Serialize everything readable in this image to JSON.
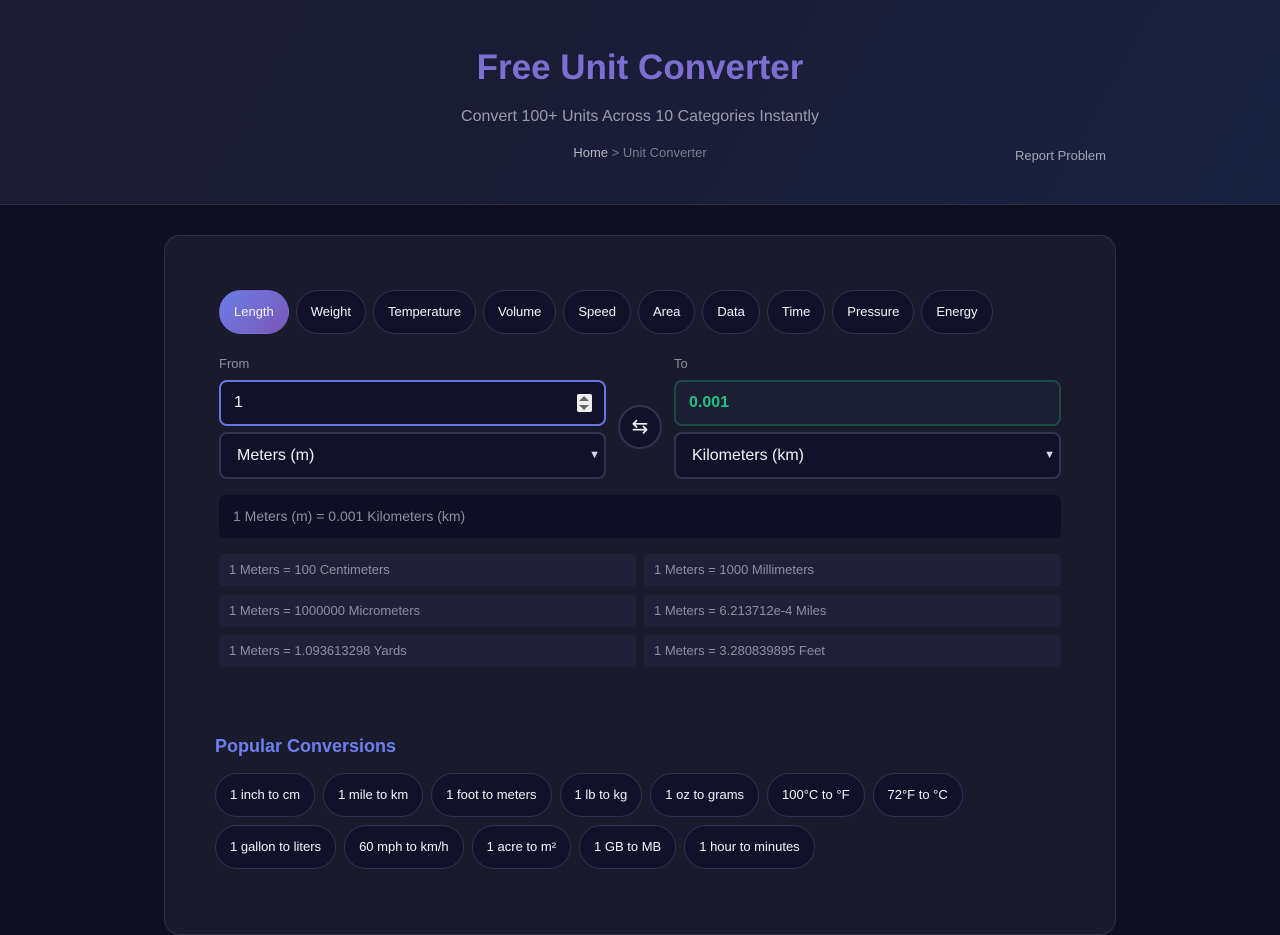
{
  "header": {
    "title": "Free Unit Converter",
    "subtitle": "Convert 100+ Units Across 10 Categories Instantly",
    "breadcrumb": {
      "home": "Home",
      "separator": ">",
      "current": "Unit Converter"
    },
    "report_label": "Report Problem"
  },
  "converter": {
    "tabs": [
      {
        "label": "Length",
        "active": true
      },
      {
        "label": "Weight",
        "active": false
      },
      {
        "label": "Temperature",
        "active": false
      },
      {
        "label": "Volume",
        "active": false
      },
      {
        "label": "Speed",
        "active": false
      },
      {
        "label": "Area",
        "active": false
      },
      {
        "label": "Data",
        "active": false
      },
      {
        "label": "Time",
        "active": false
      },
      {
        "label": "Pressure",
        "active": false
      },
      {
        "label": "Energy",
        "active": false
      }
    ],
    "from": {
      "label": "From",
      "value": "1",
      "unit": "Meters (m)"
    },
    "to": {
      "label": "To",
      "value": "0.001",
      "unit": "Kilometers (km)"
    },
    "swap_icon": "⇆",
    "result": "1 Meters (m) = 0.001 Kilometers (km)",
    "related": [
      "1 Meters = 100 Centimeters",
      "1 Meters = 1000 Millimeters",
      "1 Meters = 1000000 Micrometers",
      "1 Meters = 6.213712e-4 Miles",
      "1 Meters = 1.093613298 Yards",
      "1 Meters = 3.280839895 Feet"
    ]
  },
  "popular": {
    "title": "Popular Conversions",
    "row1": [
      "1 inch to cm",
      "1 mile to km",
      "1 foot to meters",
      "1 lb to kg",
      "1 oz to grams",
      "100°C to °F",
      "72°F to °C"
    ],
    "row2": [
      "1 gallon to liters",
      "60 mph to km/h",
      "1 acre to m²",
      "1 GB to MB",
      "1 hour to minutes"
    ]
  },
  "colors": {
    "accent": "#7d6ed2",
    "active_tab_start": "#6a7fe6",
    "active_tab_end": "#7b55b8",
    "result_value": "#23c081",
    "section_title": "#6d7ff0"
  }
}
